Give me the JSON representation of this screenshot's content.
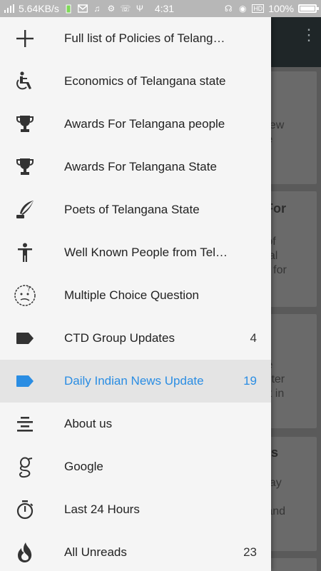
{
  "status_bar": {
    "speed": "5.64KB/s",
    "time": "4:31",
    "hd": "HD",
    "battery": "100%"
  },
  "background": {
    "cards": [
      {
        "lines": [
          "",
          "t new",
          "me"
        ]
      },
      {
        "lines": [
          "r For",
          "",
          "e of",
          "ocal",
          "ter for"
        ]
      },
      {
        "lines": [
          "",
          "the",
          "nister",
          "mit in"
        ]
      },
      {
        "lines": [
          "ays",
          "",
          "oday",
          "",
          "o and"
        ]
      }
    ]
  },
  "drawer": {
    "items": [
      {
        "label": "Full list of Policies of Telangana...",
        "icon": "plus-icon",
        "count": ""
      },
      {
        "label": "Economics of Telangana state",
        "icon": "wheelchair-icon",
        "count": ""
      },
      {
        "label": "Awards For Telangana people",
        "icon": "trophy-icon",
        "count": ""
      },
      {
        "label": "Awards For Telangana State",
        "icon": "trophy-icon",
        "count": ""
      },
      {
        "label": "Poets of Telangana State",
        "icon": "quill-icon",
        "count": ""
      },
      {
        "label": "Well Known People from Telang...",
        "icon": "person-icon",
        "count": ""
      },
      {
        "label": "Multiple Choice Question",
        "icon": "confused-face-icon",
        "count": ""
      },
      {
        "label": "CTD Group Updates",
        "icon": "tag-icon",
        "count": "4"
      },
      {
        "label": "Daily Indian News Update",
        "icon": "tag-icon",
        "count": "19",
        "active": true
      },
      {
        "label": "About us",
        "icon": "align-center-icon",
        "count": ""
      },
      {
        "label": "Google",
        "icon": "google-icon",
        "count": ""
      },
      {
        "label": "Last 24 Hours",
        "icon": "stopwatch-icon",
        "count": ""
      },
      {
        "label": "All Unreads",
        "icon": "flame-icon",
        "count": "23"
      }
    ],
    "accent_color": "#2a8de3"
  }
}
